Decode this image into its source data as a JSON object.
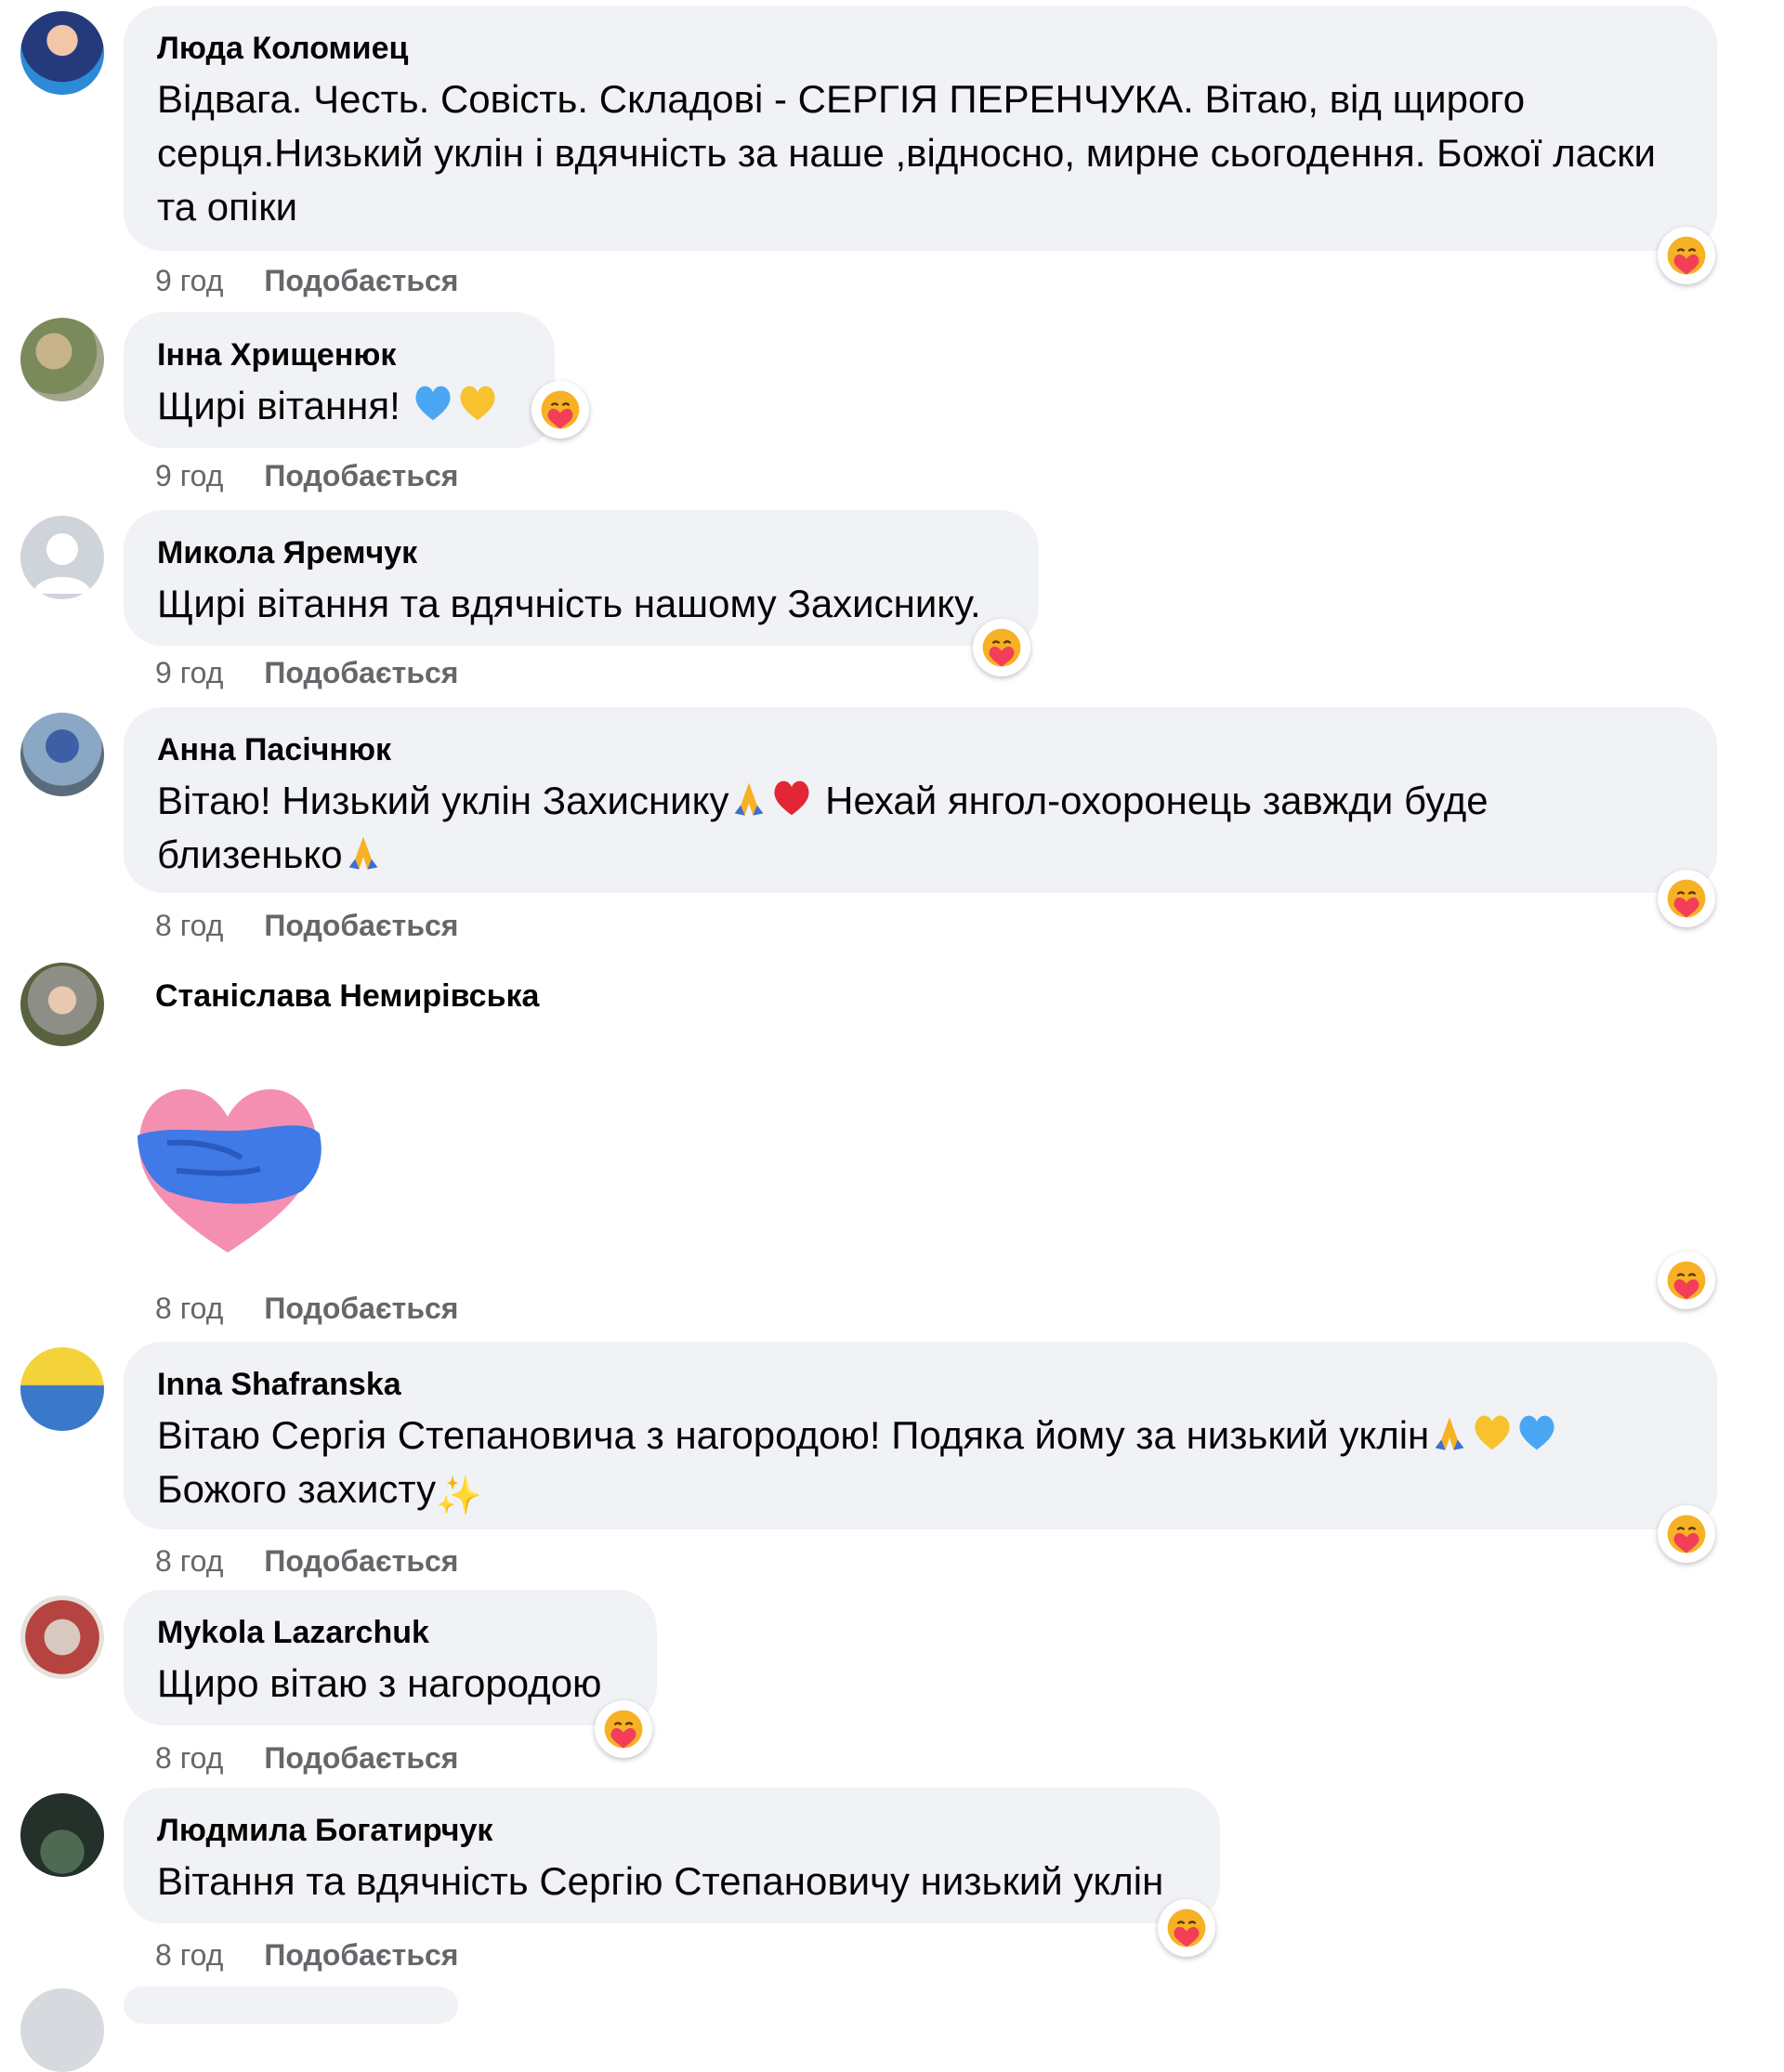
{
  "like_label": "Подобається",
  "comments": [
    {
      "author": "Люда Коломиец",
      "text": "Відвага. Честь. Совість. Складові - СЕРГІЯ ПЕРЕНЧУКА. Вітаю, від щирого серця.Низький уклін і вдячність за наше ,відносно, мирне сьогодення. Божої ласки та опіки",
      "time": "9 год"
    },
    {
      "author": "Інна Хрищенюк",
      "text": "Щирі вітання!",
      "emoji": [
        "blue-heart",
        "yellow-heart"
      ],
      "time": "9 год"
    },
    {
      "author": "Микола Яремчук",
      "text": "Щирі вітання та вдячність нашому Захиснику.",
      "time": "9 год"
    },
    {
      "author": "Анна Пасічнюк",
      "text_part1": "Вітаю! Низький уклін Захиснику",
      "text_part2": " Нехай янгол-охоронець завжди буде близенько",
      "time": "8 год"
    },
    {
      "author": "Станіслава Немирівська",
      "sticker": "hugging-heart-sticker",
      "time": "8 год"
    },
    {
      "author": "Inna Shafranska",
      "text_part1": "Вітаю Сергія Степановича з нагородою! Подяка йому за низький уклін",
      "text_part2": "Божого захисту",
      "time": "8 год"
    },
    {
      "author": "Mykola Lazarchuk",
      "text": "Щиро вітаю з нагородою",
      "time": "8 год"
    },
    {
      "author": "Людмила Богатирчук",
      "text": "Вітання та вдячність Сергію Степановичу низький уклін",
      "time": "8 год"
    }
  ],
  "reaction_icon": "care-reaction-icon"
}
